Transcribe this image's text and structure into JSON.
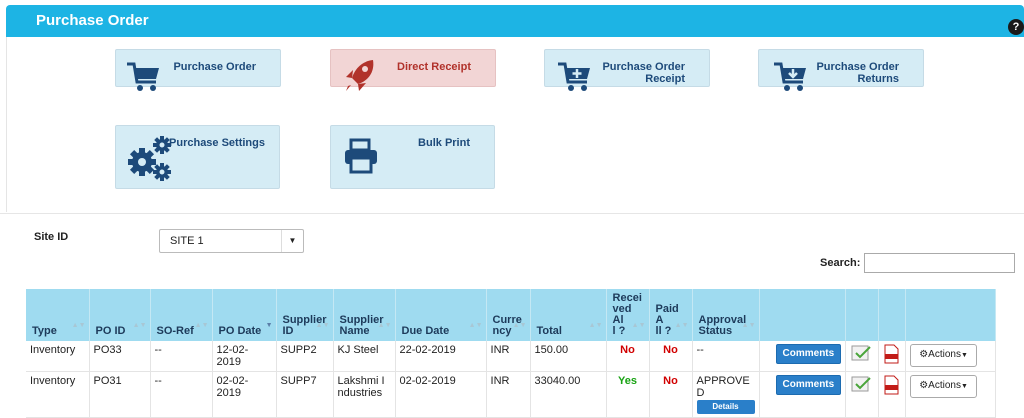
{
  "header": {
    "title": "Purchase Order",
    "help_glyph": "?"
  },
  "tiles": [
    {
      "label_lines": [
        "Purchase Order"
      ],
      "icon": "cart-icon"
    },
    {
      "label_lines": [
        "Direct Receipt"
      ],
      "icon": "rocket-icon"
    },
    {
      "label_lines": [
        "Purchase Order",
        "Receipt"
      ],
      "icon": "cart-plus-icon"
    },
    {
      "label_lines": [
        "Purchase Order",
        "Returns"
      ],
      "icon": "cart-return-icon"
    },
    {
      "label_lines": [
        "Purchase Settings"
      ],
      "icon": "gears-icon"
    },
    {
      "label_lines": [
        "Bulk Print"
      ],
      "icon": "printer-icon"
    }
  ],
  "filters": {
    "site_label": "Site ID",
    "site_value": "SITE 1",
    "search_label": "Search:",
    "search_value": ""
  },
  "table": {
    "columns": [
      "Type",
      "PO ID",
      "SO-Ref",
      "PO Date",
      "Supplier ID",
      "Supplier Name",
      "Due Date",
      "Currency",
      "Total",
      "Received All ?",
      "Paid All ?",
      "Approval Status"
    ],
    "column_display": [
      "Type",
      "PO ID",
      "SO-Ref",
      "PO Date",
      "Supplier\nID",
      "Supplier\nName",
      "Due Date",
      "Curre\nncy",
      "Total",
      "Recei\nved Al\nl ?",
      "Paid A\nll ?",
      "Approval\nStatus"
    ],
    "rows": [
      {
        "type": "Inventory",
        "po_id": "PO33",
        "so_ref": "--",
        "po_date": "12-02-2019",
        "supplier_id": "SUPP2",
        "supplier_name": "KJ Steel",
        "due_date": "22-02-2019",
        "currency": "INR",
        "total": "150.00",
        "received": "No",
        "paid": "No",
        "approval": "--",
        "has_details": false
      },
      {
        "type": "Inventory",
        "po_id": "PO31",
        "so_ref": "--",
        "po_date": "02-02-2019",
        "supplier_id": "SUPP7",
        "supplier_name": "Lakshmi Industries",
        "due_date": "02-02-2019",
        "currency": "INR",
        "total": "33040.00",
        "received": "Yes",
        "paid": "No",
        "approval": "APPROVED",
        "has_details": true
      }
    ],
    "comments_label": "Comments",
    "details_label": "Details",
    "actions_label": "Actions"
  },
  "colors": {
    "header": "#1db4e4",
    "tile": "#d5ecf5",
    "tile_red": "#f2d5d5",
    "table_header": "#9fdbf0",
    "yes": "#18a313",
    "no": "#d10000",
    "button": "#2a7fc9"
  }
}
